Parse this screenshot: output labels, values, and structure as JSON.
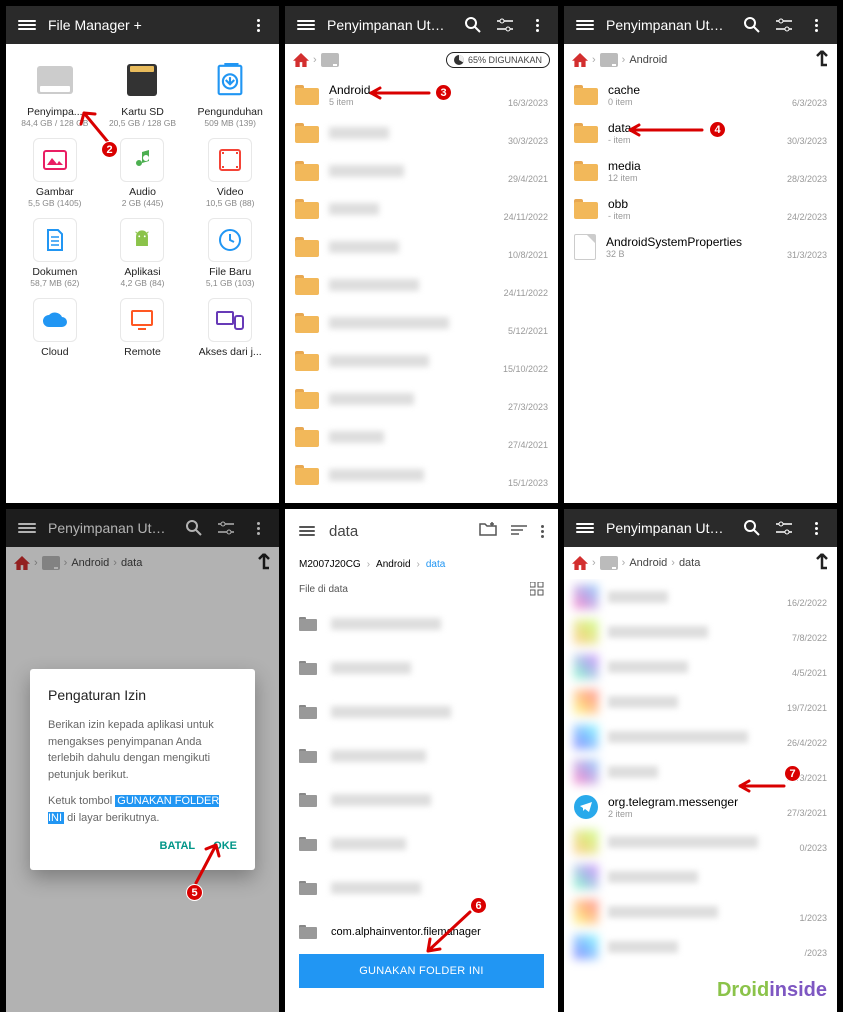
{
  "panel1": {
    "title": "File Manager +",
    "items": [
      {
        "label": "Penyimpa...",
        "sub": "84,4 GB / 128 GB"
      },
      {
        "label": "Kartu SD",
        "sub": "20,5 GB / 128 GB"
      },
      {
        "label": "Pengunduhan",
        "sub": "509 MB (139)"
      },
      {
        "label": "Gambar",
        "sub": "5,5 GB (1405)"
      },
      {
        "label": "Audio",
        "sub": "2 GB (445)"
      },
      {
        "label": "Video",
        "sub": "10,5 GB (88)"
      },
      {
        "label": "Dokumen",
        "sub": "58,7 MB (62)"
      },
      {
        "label": "Aplikasi",
        "sub": "4,2 GB (84)"
      },
      {
        "label": "File Baru",
        "sub": "5,1 GB (103)"
      },
      {
        "label": "Cloud",
        "sub": ""
      },
      {
        "label": "Remote",
        "sub": ""
      },
      {
        "label": "Akses dari j...",
        "sub": ""
      }
    ]
  },
  "panel2": {
    "title": "Penyimpanan Ut…",
    "storage_used": "65% DIGUNAKAN",
    "first_row": {
      "name": "Android",
      "sub": "5 item",
      "date": "16/3/2023"
    },
    "dates": [
      "30/3/2023",
      "29/4/2021",
      "24/11/2022",
      "10/8/2021",
      "24/11/2022",
      "5/12/2021",
      "15/10/2022",
      "27/3/2023",
      "27/4/2021",
      "15/1/2023"
    ]
  },
  "panel3": {
    "title": "Penyimpanan Ut…",
    "breadcrumb": "Android",
    "rows": [
      {
        "name": "cache",
        "sub": "0 item",
        "date": "6/3/2023"
      },
      {
        "name": "data",
        "sub": "- item",
        "date": "30/3/2023"
      },
      {
        "name": "media",
        "sub": "12 item",
        "date": "28/3/2023"
      },
      {
        "name": "obb",
        "sub": "- item",
        "date": "24/2/2023"
      }
    ],
    "file_row": {
      "name": "AndroidSystemProperties",
      "sub": "32 B",
      "date": "31/3/2023"
    }
  },
  "panel4": {
    "title": "Penyimpanan Ut…",
    "bc1": "Android",
    "bc2": "data",
    "dialog": {
      "title": "Pengaturan Izin",
      "text1": "Berikan izin kepada aplikasi untuk mengakses penyimpanan Anda terlebih dahulu dengan mengikuti petunjuk berikut.",
      "text2a": "Ketuk tombol ",
      "text2hl": "GUNAKAN FOLDER INI",
      "text2b": " di layar berikutnya.",
      "cancel": "BATAL",
      "ok": "OKE"
    }
  },
  "panel5": {
    "title": "data",
    "bc_device": "M2007J20CG",
    "bc1": "Android",
    "bc2": "data",
    "section": "File di data",
    "last_folder": "com.alphainventor.filemanager",
    "button": "GUNAKAN FOLDER INI"
  },
  "panel6": {
    "title": "Penyimpanan Ut…",
    "bc1": "Android",
    "bc2": "data",
    "dates": [
      "16/2/2022",
      "7/8/2022",
      "4/5/2021",
      "19/7/2021",
      "26/4/2022",
      "27/3/2021"
    ],
    "tg": {
      "name": "org.telegram.messenger",
      "sub": "2 item",
      "date": "27/3/2021"
    },
    "dates2": [
      "0/2023",
      "1/2023",
      "/2023"
    ]
  },
  "watermark": {
    "a": "Droid",
    "b": "inside"
  }
}
